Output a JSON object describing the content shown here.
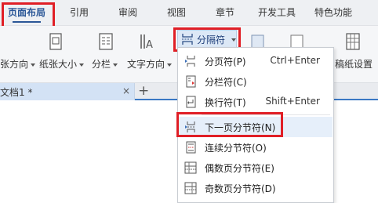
{
  "tabs": [
    {
      "label": "页面布局",
      "active": true
    },
    {
      "label": "引用",
      "active": false
    },
    {
      "label": "审阅",
      "active": false
    },
    {
      "label": "视图",
      "active": false
    },
    {
      "label": "章节",
      "active": false
    },
    {
      "label": "开发工具",
      "active": false
    },
    {
      "label": "特色功能",
      "active": false
    }
  ],
  "ribbon": {
    "orientation_label": "张方向",
    "paper_size_label": "纸张大小",
    "columns_label": "分栏",
    "text_direction_label": "文字方向",
    "breaks_label": "分隔符",
    "manuscript_label": "稿纸设置"
  },
  "document_tab": {
    "title": "文档1 *",
    "close": "×",
    "add": "+"
  },
  "menu": {
    "items": [
      {
        "label": "分页符(P)",
        "shortcut": "Ctrl+Enter",
        "icon": "page-break-icon"
      },
      {
        "label": "分栏符(C)",
        "shortcut": "",
        "icon": "column-break-icon"
      },
      {
        "label": "换行符(T)",
        "shortcut": "Shift+Enter",
        "icon": "line-break-icon"
      },
      {
        "label": "下一页分节符(N)",
        "shortcut": "",
        "icon": "next-page-section-icon"
      },
      {
        "label": "连续分节符(O)",
        "shortcut": "",
        "icon": "continuous-section-icon"
      },
      {
        "label": "偶数页分节符(E)",
        "shortcut": "",
        "icon": "even-page-section-icon"
      },
      {
        "label": "奇数页分节符(D)",
        "shortcut": "",
        "icon": "odd-page-section-icon"
      }
    ]
  },
  "colors": {
    "highlight_box": "#e01f26",
    "accent": "#2b5797",
    "menu_hover": "#e6effa"
  }
}
